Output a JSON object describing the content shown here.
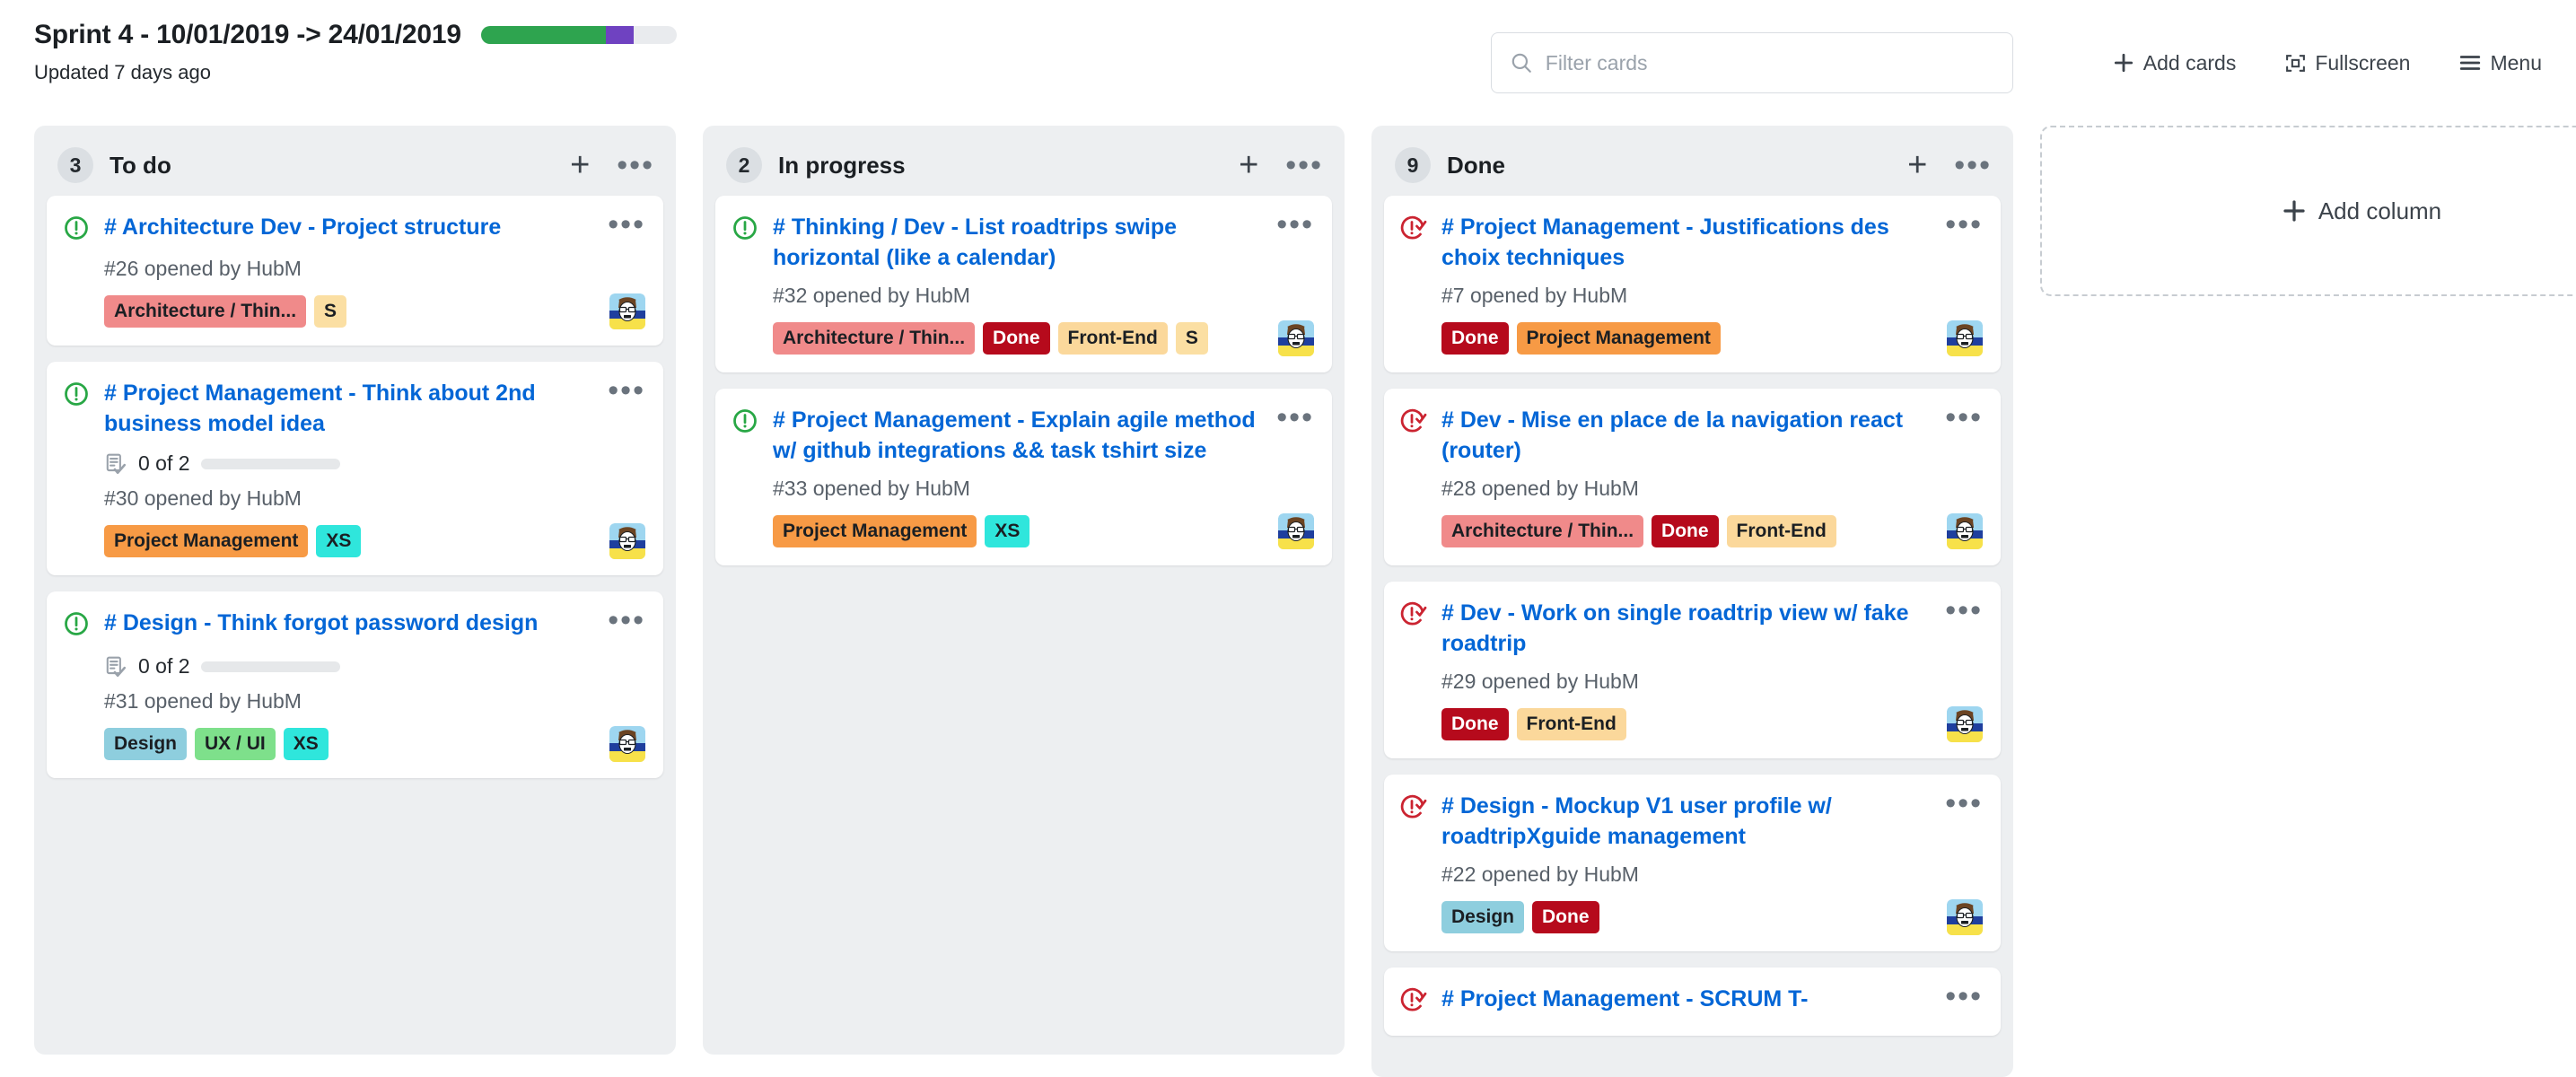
{
  "header": {
    "sprint_title": "Sprint 4 - 10/01/2019 -> 24/01/2019",
    "updated_text": "Updated 7 days ago",
    "progress": {
      "green_pct": 64,
      "purple_pct": 14,
      "remaining_pct": 22,
      "green_color": "#2ea44f",
      "purple_color": "#6f42c1",
      "track_color": "#e9ebee"
    },
    "search": {
      "placeholder": "Filter cards",
      "value": "",
      "icon": "search-icon"
    },
    "buttons": [
      {
        "label": "Add cards",
        "icon": "plus-icon"
      },
      {
        "label": "Fullscreen",
        "icon": "fullscreen-icon"
      },
      {
        "label": "Menu",
        "icon": "hamburger-menu-icon"
      }
    ]
  },
  "board": {
    "add_column": {
      "label": "Add column",
      "icon": "plus-icon"
    },
    "columns": [
      {
        "name": "To do",
        "count": "3",
        "add_icon": "plus-icon",
        "more_icon": "ellipsis-icon",
        "cards": [
          {
            "status_icon": "issue-open-icon",
            "title": "# Architecture Dev - Project structure",
            "meta": "#26 opened by HubM",
            "checklist": null,
            "labels": [
              {
                "text": "Architecture / Thin...",
                "bg": "#f08a8a",
                "fg": "#1b1f23"
              },
              {
                "text": "S",
                "bg": "#fbdfa3",
                "fg": "#1b1f23"
              }
            ],
            "avatar": "user-avatar"
          },
          {
            "status_icon": "issue-open-icon",
            "title": "# Project Management - Think about 2nd business model idea",
            "meta": "#30 opened by HubM",
            "checklist": {
              "icon": "checklist-icon",
              "text": "0 of 2",
              "progress_pct": 0
            },
            "labels": [
              {
                "text": "Project Management",
                "bg": "#f79a45",
                "fg": "#1b1f23"
              },
              {
                "text": "XS",
                "bg": "#2fe6dc",
                "fg": "#1b1f23"
              }
            ],
            "avatar": "user-avatar"
          },
          {
            "status_icon": "issue-open-icon",
            "title": "# Design - Think forgot password design",
            "meta": "#31 opened by HubM",
            "checklist": {
              "icon": "checklist-icon",
              "text": "0 of 2",
              "progress_pct": 0
            },
            "labels": [
              {
                "text": "Design",
                "bg": "#8ecede",
                "fg": "#1b1f23"
              },
              {
                "text": "UX / UI",
                "bg": "#7ee08b",
                "fg": "#1b1f23"
              },
              {
                "text": "XS",
                "bg": "#2fe6dc",
                "fg": "#1b1f23"
              }
            ],
            "avatar": "user-avatar"
          }
        ]
      },
      {
        "name": "In progress",
        "count": "2",
        "add_icon": "plus-icon",
        "more_icon": "ellipsis-icon",
        "cards": [
          {
            "status_icon": "issue-open-icon",
            "title": "# Thinking / Dev - List roadtrips swipe horizontal (like a calendar)",
            "meta": "#32 opened by HubM",
            "checklist": null,
            "labels": [
              {
                "text": "Architecture / Thin...",
                "bg": "#f08a8a",
                "fg": "#1b1f23"
              },
              {
                "text": "Done",
                "bg": "#b60a1c",
                "fg": "#ffffff"
              },
              {
                "text": "Front-End",
                "bg": "#fbd89b",
                "fg": "#1b1f23"
              },
              {
                "text": "S",
                "bg": "#fbdfa3",
                "fg": "#1b1f23"
              }
            ],
            "avatar": "user-avatar"
          },
          {
            "status_icon": "issue-open-icon",
            "title": "# Project Management - Explain agile method w/ github integrations && task tshirt size",
            "meta": "#33 opened by HubM",
            "checklist": null,
            "labels": [
              {
                "text": "Project Management",
                "bg": "#f79a45",
                "fg": "#1b1f23"
              },
              {
                "text": "XS",
                "bg": "#2fe6dc",
                "fg": "#1b1f23"
              }
            ],
            "avatar": "user-avatar"
          }
        ]
      },
      {
        "name": "Done",
        "count": "9",
        "add_icon": "plus-icon",
        "more_icon": "ellipsis-icon",
        "cards": [
          {
            "status_icon": "issue-closed-icon",
            "title": "# Project Management - Justifications des choix techniques",
            "meta": "#7 opened by HubM",
            "checklist": null,
            "labels": [
              {
                "text": "Done",
                "bg": "#b60a1c",
                "fg": "#ffffff"
              },
              {
                "text": "Project Management",
                "bg": "#f79a45",
                "fg": "#1b1f23"
              }
            ],
            "avatar": "user-avatar"
          },
          {
            "status_icon": "issue-closed-icon",
            "title": "# Dev - Mise en place de la navigation react (router)",
            "meta": "#28 opened by HubM",
            "checklist": null,
            "labels": [
              {
                "text": "Architecture / Thin...",
                "bg": "#f08a8a",
                "fg": "#1b1f23"
              },
              {
                "text": "Done",
                "bg": "#b60a1c",
                "fg": "#ffffff"
              },
              {
                "text": "Front-End",
                "bg": "#fbd89b",
                "fg": "#1b1f23"
              }
            ],
            "avatar": "user-avatar"
          },
          {
            "status_icon": "issue-closed-icon",
            "title": "# Dev - Work on single roadtrip view w/ fake roadtrip",
            "meta": "#29 opened by HubM",
            "checklist": null,
            "labels": [
              {
                "text": "Done",
                "bg": "#b60a1c",
                "fg": "#ffffff"
              },
              {
                "text": "Front-End",
                "bg": "#fbd89b",
                "fg": "#1b1f23"
              }
            ],
            "avatar": "user-avatar"
          },
          {
            "status_icon": "issue-closed-icon",
            "title": "# Design - Mockup V1 user profile w/ roadtripXguide management",
            "meta": "#22 opened by HubM",
            "checklist": null,
            "labels": [
              {
                "text": "Design",
                "bg": "#8ecede",
                "fg": "#1b1f23"
              },
              {
                "text": "Done",
                "bg": "#b60a1c",
                "fg": "#ffffff"
              }
            ],
            "avatar": "user-avatar"
          },
          {
            "status_icon": "issue-closed-icon",
            "title": "# Project Management - SCRUM T-",
            "meta": "",
            "checklist": null,
            "labels": [],
            "avatar": null,
            "clipped": true
          }
        ]
      }
    ]
  }
}
